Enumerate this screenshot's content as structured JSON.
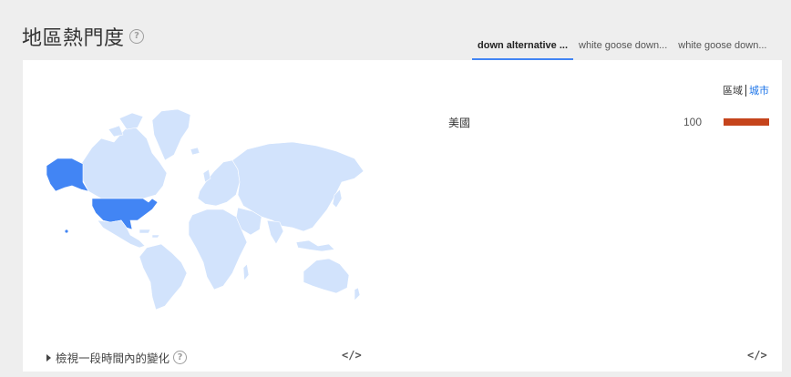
{
  "header": {
    "title": "地區熱門度"
  },
  "tabs": [
    {
      "label": "down alternative ...",
      "active": true
    },
    {
      "label": "white goose down...",
      "active": false
    },
    {
      "label": "white goose down...",
      "active": false
    }
  ],
  "resolution": {
    "region_label": "區域",
    "city_label": "城市"
  },
  "regions": [
    {
      "name": "美國",
      "value": "100"
    }
  ],
  "timeline": {
    "label": "檢視一段時間內的變化"
  },
  "colors": {
    "accent": "#4285f4",
    "bar": "#c5441c",
    "map_land": "#d2e3fc",
    "map_highlight": "#4285f4"
  }
}
